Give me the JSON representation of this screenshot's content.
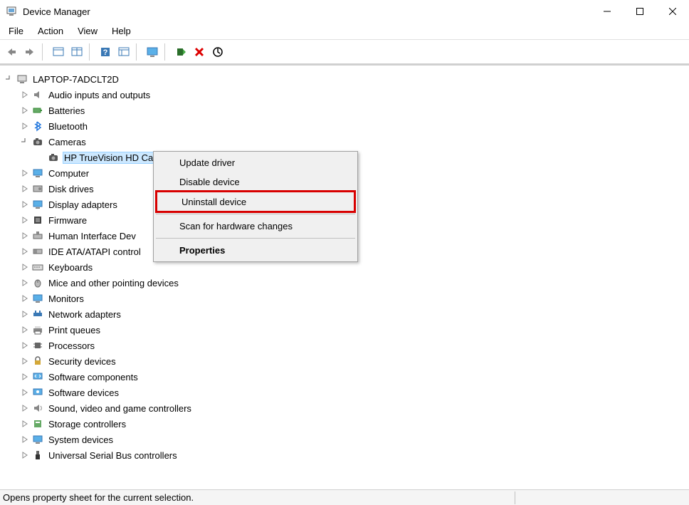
{
  "window": {
    "title": "Device Manager"
  },
  "menu": {
    "file": "File",
    "action": "Action",
    "view": "View",
    "help": "Help"
  },
  "tree": {
    "root": "LAPTOP-7ADCLT2D",
    "audio": "Audio inputs and outputs",
    "batteries": "Batteries",
    "bluetooth": "Bluetooth",
    "cameras": "Cameras",
    "camera_child": "HP TrueVision HD Camera",
    "computer": "Computer",
    "disk": "Disk drives",
    "display": "Display adapters",
    "firmware": "Firmware",
    "hid": "Human Interface Dev",
    "ide": "IDE ATA/ATAPI control",
    "keyboards": "Keyboards",
    "mice": "Mice and other pointing devices",
    "monitors": "Monitors",
    "network": "Network adapters",
    "print": "Print queues",
    "processors": "Processors",
    "security": "Security devices",
    "swcomp": "Software components",
    "swdev": "Software devices",
    "sound": "Sound, video and game controllers",
    "storage": "Storage controllers",
    "system": "System devices",
    "usb": "Universal Serial Bus controllers"
  },
  "context_menu": {
    "update": "Update driver",
    "disable": "Disable device",
    "uninstall": "Uninstall device",
    "scan": "Scan for hardware changes",
    "properties": "Properties"
  },
  "statusbar": {
    "text": "Opens property sheet for the current selection."
  }
}
